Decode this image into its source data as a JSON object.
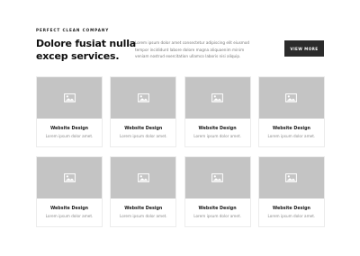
{
  "header": {
    "eyebrow": "PERFECT CLEAN COMPANY",
    "headline": "Dolore fusiat nulla excep services.",
    "intro": "Lorem ipsum dolor amet consectetur adipiscing elit eiusmod tempor incididunt labore dolore magna aliquaenim minim veniam nostrud exercitation ullamco laboris nisi aliquip.",
    "button_label": "VIEW MORE"
  },
  "cards": [
    {
      "title": "Website Design",
      "description": "Lorem ipsum dolor amet.",
      "icon": "image-placeholder-icon"
    },
    {
      "title": "Website Design",
      "description": "Lorem ipsum dolor amet.",
      "icon": "image-placeholder-icon"
    },
    {
      "title": "Website Design",
      "description": "Lorem ipsum dolor amet.",
      "icon": "image-placeholder-icon"
    },
    {
      "title": "Website Design",
      "description": "Lorem ipsum dolor amet.",
      "icon": "image-placeholder-icon"
    },
    {
      "title": "Website Design",
      "description": "Lorem ipsum dolor amet.",
      "icon": "image-placeholder-icon"
    },
    {
      "title": "Website Design",
      "description": "Lorem ipsum dolor amet.",
      "icon": "image-placeholder-icon"
    },
    {
      "title": "Website Design",
      "description": "Lorem ipsum dolor amet.",
      "icon": "image-placeholder-icon"
    },
    {
      "title": "Website Design",
      "description": "Lorem ipsum dolor amet.",
      "icon": "image-placeholder-icon"
    }
  ],
  "colors": {
    "button_background": "#2b2b2b",
    "placeholder_background": "#c4c4c4",
    "placeholder_icon": "#ffffff"
  }
}
